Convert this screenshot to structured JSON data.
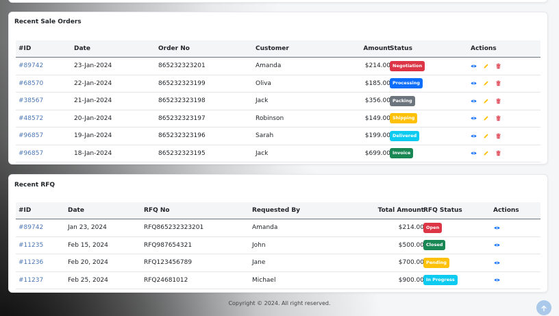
{
  "status_colors": {
    "Negotiation": "#dc3545",
    "Processing": "#0d6efd",
    "Packing": "#6c757d",
    "Shipping": "#ffc107",
    "Delivered": "#0dcaf0",
    "Invoice": "#198754",
    "Open": "#dc3545",
    "Closed": "#198754",
    "Pending": "#ffc107",
    "In Progress": "#0dcaf0"
  },
  "sale_orders": {
    "title": "Recent Sale Orders",
    "headers": {
      "id": "#ID",
      "date": "Date",
      "order_no": "Order No",
      "customer": "Customer",
      "amount": "Amount",
      "status": "Status",
      "actions": "Actions"
    },
    "rows": [
      {
        "id": "#89742",
        "date": "23-Jan-2024",
        "order_no": "865232323201",
        "customer": "Amanda",
        "amount": "$214.00",
        "status": "Negotiation"
      },
      {
        "id": "#68570",
        "date": "22-Jan-2024",
        "order_no": "865232323199",
        "customer": "Oliva",
        "amount": "$185.00",
        "status": "Processing"
      },
      {
        "id": "#38567",
        "date": "21-Jan-2024",
        "order_no": "865232323198",
        "customer": "Jack",
        "amount": "$356.00",
        "status": "Packing"
      },
      {
        "id": "#48572",
        "date": "20-Jan-2024",
        "order_no": "865232323197",
        "customer": "Robinson",
        "amount": "$149.00",
        "status": "Shipping"
      },
      {
        "id": "#96857",
        "date": "19-Jan-2024",
        "order_no": "865232323196",
        "customer": "Sarah",
        "amount": "$199.00",
        "status": "Delivered"
      },
      {
        "id": "#96857",
        "date": "18-Jan-2024",
        "order_no": "865232323195",
        "customer": "Jack",
        "amount": "$699.00",
        "status": "Invoice"
      }
    ],
    "action_icons": [
      "eye-icon",
      "pencil-icon",
      "trash-icon"
    ]
  },
  "rfq": {
    "title": "Recent RFQ",
    "headers": {
      "id": "#ID",
      "date": "Date",
      "rfq_no": "RFQ No",
      "requested_by": "Requested By",
      "total_amount": "Total Amount",
      "status": "RFQ Status",
      "actions": "Actions"
    },
    "rows": [
      {
        "id": "#89742",
        "date": "Jan 23, 2024",
        "rfq_no": "RFQ865232323201",
        "requested_by": "Amanda",
        "total_amount": "$214.00",
        "status": "Open"
      },
      {
        "id": "#11235",
        "date": "Feb 15, 2024",
        "rfq_no": "RFQ987654321",
        "requested_by": "John",
        "total_amount": "$500.00",
        "status": "Closed"
      },
      {
        "id": "#11236",
        "date": "Feb 20, 2024",
        "rfq_no": "RFQ123456789",
        "requested_by": "Jane",
        "total_amount": "$700.00",
        "status": "Pending"
      },
      {
        "id": "#11237",
        "date": "Feb 25, 2024",
        "rfq_no": "RFQ24681012",
        "requested_by": "Michael",
        "total_amount": "$900.00",
        "status": "In Progress"
      }
    ],
    "action_icons": [
      "eye-icon"
    ]
  },
  "footer": {
    "copyright": "Copyright © 2024. All right reserved."
  },
  "scroll_top": {
    "icon": "arrow-up-icon"
  }
}
